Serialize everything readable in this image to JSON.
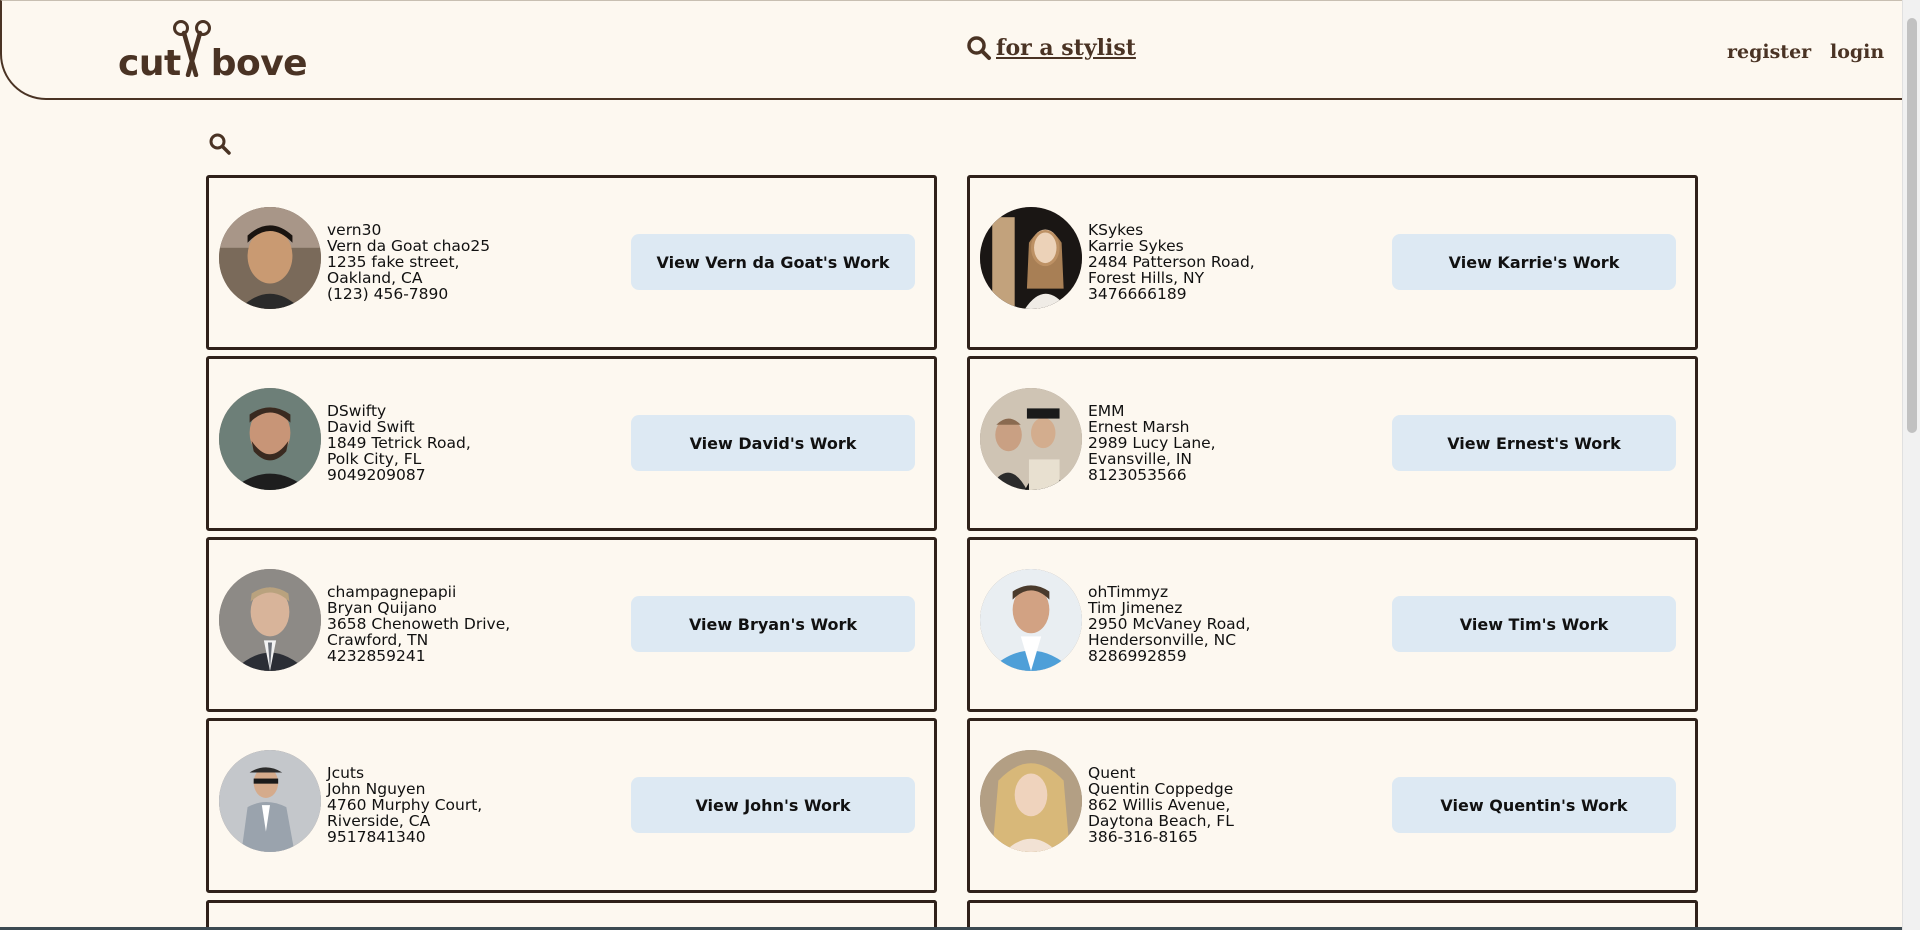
{
  "header": {
    "logo_text_left": "cut",
    "logo_text_right": "bove",
    "find_label": " for a stylist",
    "register_label": "register",
    "login_label": "login"
  },
  "colors": {
    "accent_brown": "#4a3324",
    "background": "#fdf8f0",
    "button_bg": "#dde9f3",
    "card_border": "#2f211a"
  },
  "stylists": [
    {
      "username": "vern30",
      "name": "Vern da Goat chao25",
      "street": "1235 fake street,",
      "city": "Oakland, CA",
      "phone": "(123) 456-7890",
      "button": "View Vern da Goat's Work"
    },
    {
      "username": "KSykes",
      "name": "Karrie Sykes",
      "street": "2484 Patterson Road,",
      "city": "Forest Hills, NY",
      "phone": "3476666189",
      "button": "View Karrie's Work"
    },
    {
      "username": "DSwifty",
      "name": "David Swift",
      "street": "1849 Tetrick Road,",
      "city": "Polk City, FL",
      "phone": "9049209087",
      "button": "View David's Work"
    },
    {
      "username": "EMM",
      "name": "Ernest Marsh",
      "street": "2989 Lucy Lane,",
      "city": "Evansville, IN",
      "phone": "8123053566",
      "button": "View Ernest's Work"
    },
    {
      "username": "champagnepapii",
      "name": "Bryan Quijano",
      "street": "3658 Chenoweth Drive,",
      "city": "Crawford, TN",
      "phone": "4232859241",
      "button": "View Bryan's Work"
    },
    {
      "username": "ohTimmyz",
      "name": "Tim Jimenez",
      "street": "2950 McVaney Road,",
      "city": "Hendersonville, NC",
      "phone": "8286992859",
      "button": "View Tim's Work"
    },
    {
      "username": "Jcuts",
      "name": "John Nguyen",
      "street": "4760 Murphy Court,",
      "city": "Riverside, CA",
      "phone": "9517841340",
      "button": "View John's Work"
    },
    {
      "username": "Quent",
      "name": "Quentin Coppedge",
      "street": "862 Willis Avenue,",
      "city": "Daytona Beach, FL",
      "phone": "386-316-8165",
      "button": "View Quentin's Work"
    }
  ]
}
